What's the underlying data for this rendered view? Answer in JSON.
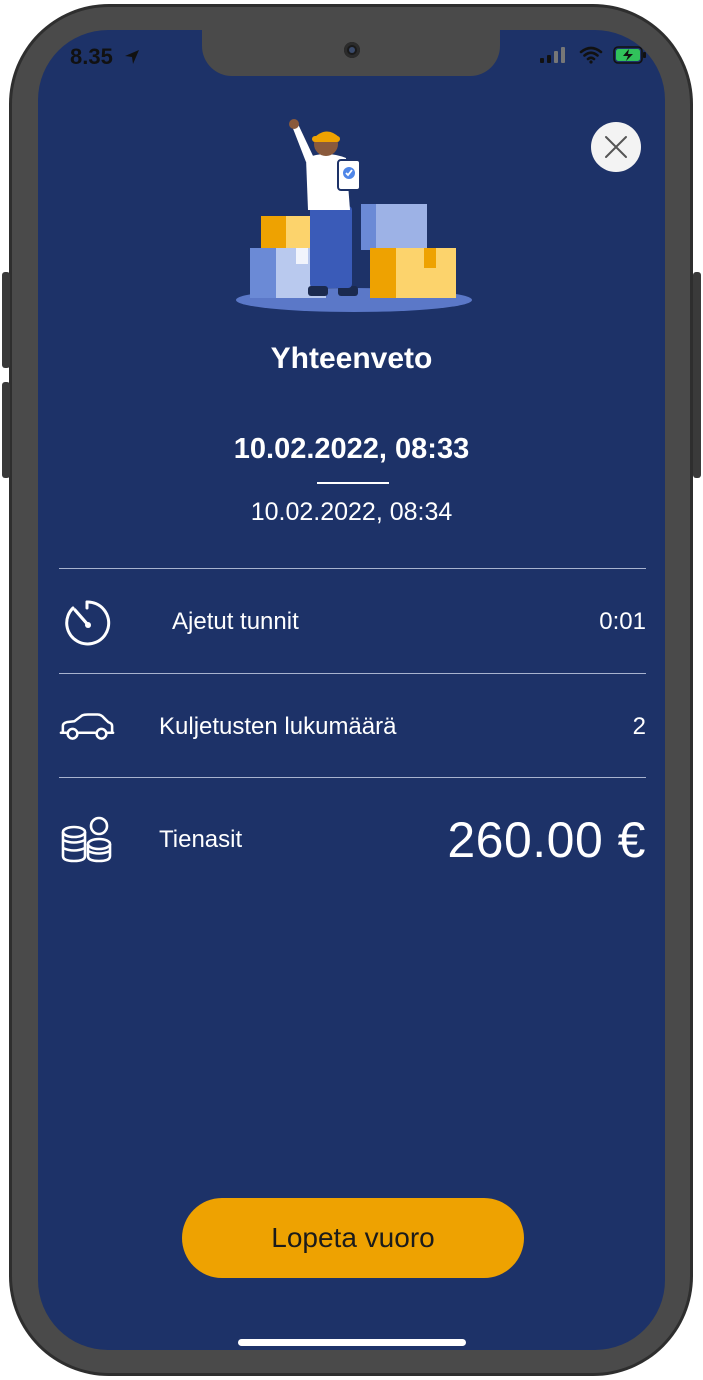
{
  "status_bar": {
    "time": "8.35"
  },
  "summary": {
    "title": "Yhteenveto",
    "start_datetime": "10.02.2022, 08:33",
    "end_datetime": "10.02.2022, 08:34"
  },
  "rows": [
    {
      "label": "Ajetut tunnit",
      "value": "0:01",
      "icon": "stopwatch-icon"
    },
    {
      "label": "Kuljetusten lukumäärä",
      "value": "2",
      "icon": "car-icon"
    },
    {
      "label": "Tienasit",
      "value": "260.00 €",
      "icon": "coins-icon"
    }
  ],
  "actions": {
    "end_shift_label": "Lopeta vuoro"
  },
  "colors": {
    "background": "#1d3268",
    "accent": "#eea201",
    "text": "#ffffff"
  }
}
